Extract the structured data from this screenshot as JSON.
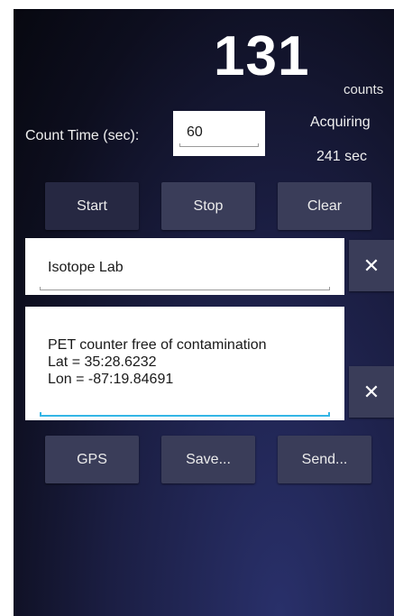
{
  "counter": {
    "value": "131",
    "unit": "counts",
    "status": "Acquiring",
    "elapsed": "241 sec"
  },
  "count_time": {
    "label": "Count Time (sec):",
    "value": "60"
  },
  "controls": {
    "start": "Start",
    "stop": "Stop",
    "clear": "Clear"
  },
  "location": {
    "value": "Isotope Lab",
    "clear_icon": "close-icon"
  },
  "notes": {
    "lines": [
      "PET counter free of contamination",
      "Lat = 35:28.6232",
      "Lon = -87:19.84691"
    ],
    "clear_icon": "close-icon"
  },
  "actions": {
    "gps": "GPS",
    "save": "Save...",
    "send": "Send..."
  },
  "colors": {
    "accent_underline": "#33b5e5",
    "button_bg": "#3a3d59",
    "button_bg_dark": "#262842"
  }
}
